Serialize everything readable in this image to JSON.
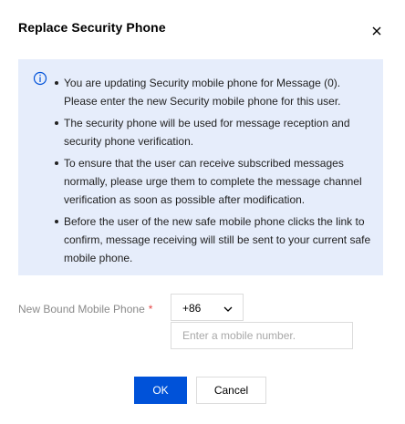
{
  "dialog": {
    "title": "Replace Security Phone",
    "close_icon": "close-icon"
  },
  "notice": {
    "icon": "info-circle-icon",
    "color": "#e6edfb",
    "items": [
      "You are updating Security mobile phone for Message (0). Please enter the new Security mobile phone for this user.",
      "The security phone will be used for message reception and security phone verification.",
      "To ensure that the user can receive subscribed messages normally, please urge them to complete the message channel verification as soon as possible after modification.",
      "Before the user of the new safe mobile phone clicks the link to confirm, message receiving will still be sent to your current safe mobile phone."
    ]
  },
  "form": {
    "label": "New Bound Mobile Phone",
    "required_mark": "*",
    "country_code": "+86",
    "phone_placeholder": "Enter a mobile number.",
    "phone_value": ""
  },
  "footer": {
    "ok_label": "OK",
    "cancel_label": "Cancel",
    "primary_color": "#0052d9"
  }
}
